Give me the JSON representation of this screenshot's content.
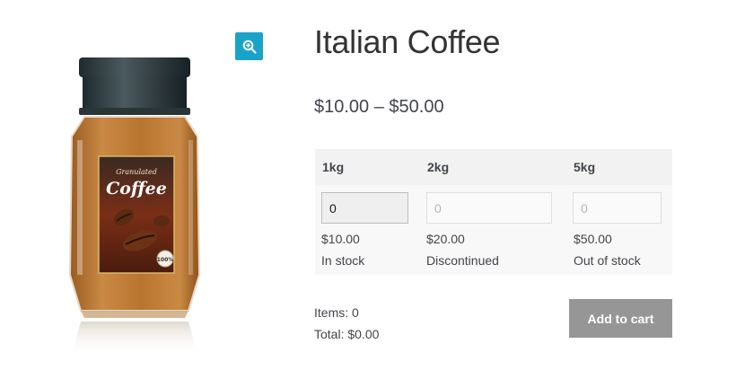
{
  "product": {
    "title": "Italian Coffee",
    "price_range": "$10.00 – $50.00",
    "image_label": "Granulated",
    "image_brand": "Coffee",
    "image_badge": "100%"
  },
  "zoom": {
    "icon": "zoom-in-icon"
  },
  "variants": [
    {
      "name": "1kg",
      "qty": "0",
      "price": "$10.00",
      "stock": "In stock",
      "enabled": true
    },
    {
      "name": "2kg",
      "qty": "0",
      "price": "$20.00",
      "stock": "Discontinued",
      "enabled": false
    },
    {
      "name": "5kg",
      "qty": "0",
      "price": "$50.00",
      "stock": "Out of stock",
      "enabled": false
    }
  ],
  "summary": {
    "items": "Items: 0",
    "total": "Total: $0.00"
  },
  "cart": {
    "label": "Add to cart"
  },
  "colors": {
    "accent": "#1aa3c9",
    "button": "#969696"
  }
}
